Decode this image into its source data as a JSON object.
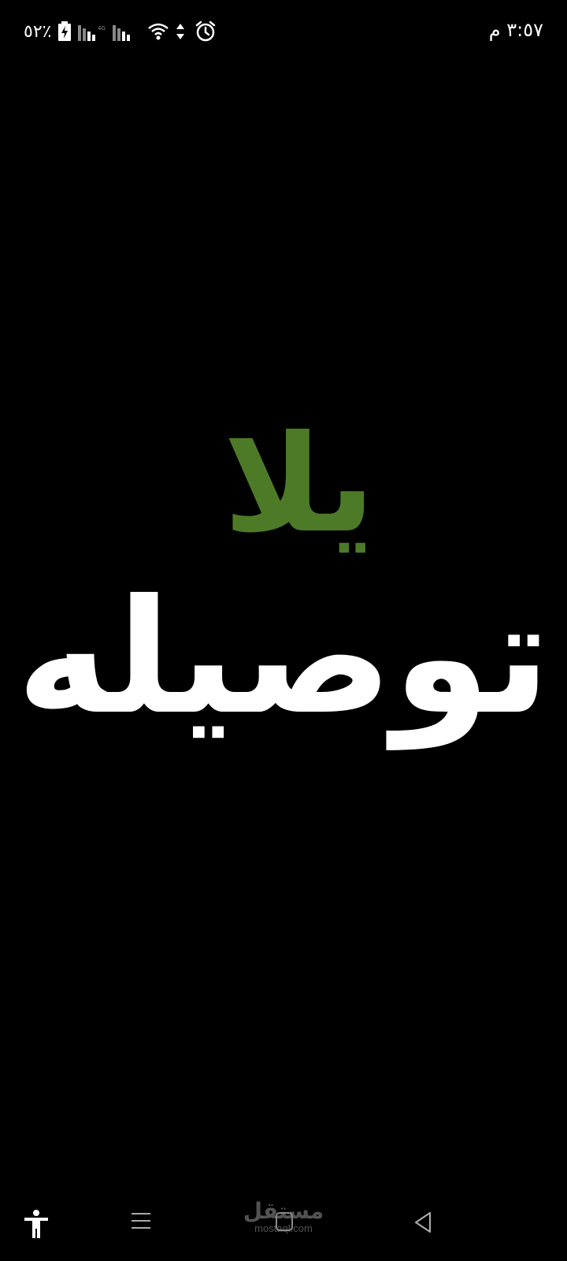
{
  "status_bar": {
    "battery_percent": "٥٢٪",
    "time": "٣:٥٧ م",
    "icons": [
      "battery-charging-icon",
      "signal-bars-icon",
      "signal-bars-4g-icon",
      "wifi-icon",
      "data-arrows-icon",
      "alarm-icon"
    ]
  },
  "logo": {
    "line1": "يلا",
    "line2": "توصيله",
    "line1_color": "#4d7a27",
    "line2_color": "#ffffff"
  },
  "watermark": {
    "arabic": "مستقل",
    "latin": "mostaql.com"
  },
  "nav_bar": {
    "buttons": [
      "accessibility-icon",
      "recents-icon",
      "home-icon",
      "back-icon"
    ]
  },
  "colors": {
    "background": "#000000",
    "brand_green": "#4d7a27"
  }
}
